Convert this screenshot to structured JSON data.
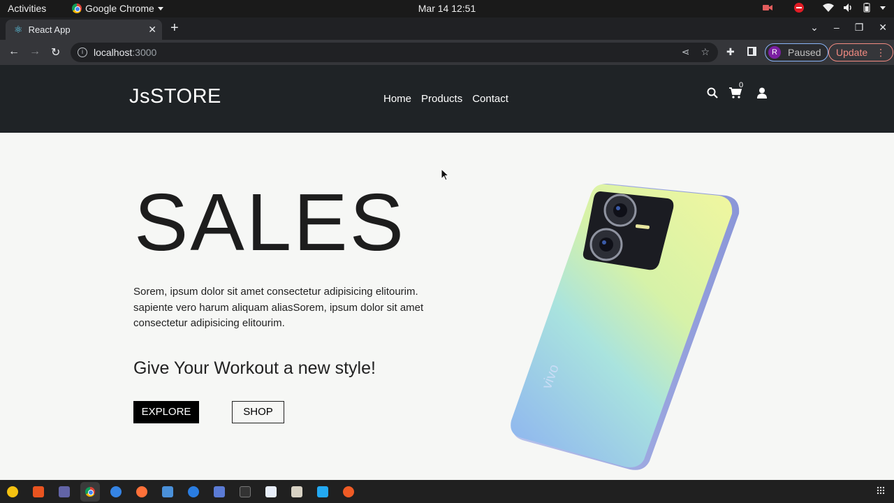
{
  "system": {
    "activities": "Activities",
    "app_name": "Google Chrome",
    "clock": "Mar 14  12:51"
  },
  "browser": {
    "tab_title": "React App",
    "url_host": "localhost",
    "url_port": ":3000",
    "profile_initial": "R",
    "profile_status": "Paused",
    "update_label": "Update"
  },
  "site": {
    "logo": "JsSTORE",
    "nav": [
      "Home",
      "Products",
      "Contact"
    ],
    "cart_count": "0"
  },
  "hero": {
    "title": "SALES",
    "paragraph": "Sorem, ipsum dolor sit amet consectetur adipisicing elitourim. sapiente vero harum aliquam aliasSorem, ipsum dolor sit amet consectetur adipisicing elitourim.",
    "subtitle": "Give Your Workout a new style!",
    "explore_label": "EXPLORE",
    "shop_label": "SHOP"
  },
  "colors": {
    "header_bg": "#1f2326",
    "page_bg": "#f6f7f5",
    "accent_black": "#000000"
  }
}
